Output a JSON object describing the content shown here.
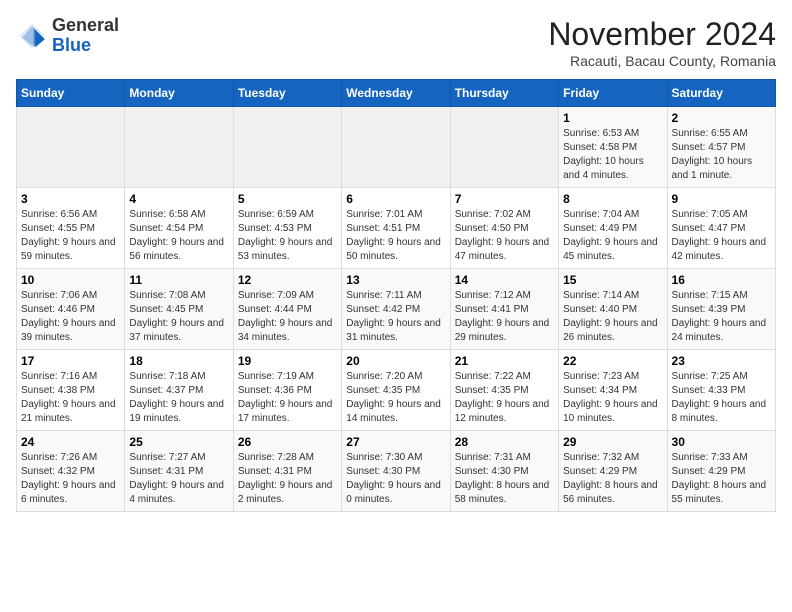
{
  "header": {
    "logo_general": "General",
    "logo_blue": "Blue",
    "month_title": "November 2024",
    "location": "Racauti, Bacau County, Romania"
  },
  "days_of_week": [
    "Sunday",
    "Monday",
    "Tuesday",
    "Wednesday",
    "Thursday",
    "Friday",
    "Saturday"
  ],
  "weeks": [
    [
      {
        "day": "",
        "info": ""
      },
      {
        "day": "",
        "info": ""
      },
      {
        "day": "",
        "info": ""
      },
      {
        "day": "",
        "info": ""
      },
      {
        "day": "",
        "info": ""
      },
      {
        "day": "1",
        "info": "Sunrise: 6:53 AM\nSunset: 4:58 PM\nDaylight: 10 hours and 4 minutes."
      },
      {
        "day": "2",
        "info": "Sunrise: 6:55 AM\nSunset: 4:57 PM\nDaylight: 10 hours and 1 minute."
      }
    ],
    [
      {
        "day": "3",
        "info": "Sunrise: 6:56 AM\nSunset: 4:55 PM\nDaylight: 9 hours and 59 minutes."
      },
      {
        "day": "4",
        "info": "Sunrise: 6:58 AM\nSunset: 4:54 PM\nDaylight: 9 hours and 56 minutes."
      },
      {
        "day": "5",
        "info": "Sunrise: 6:59 AM\nSunset: 4:53 PM\nDaylight: 9 hours and 53 minutes."
      },
      {
        "day": "6",
        "info": "Sunrise: 7:01 AM\nSunset: 4:51 PM\nDaylight: 9 hours and 50 minutes."
      },
      {
        "day": "7",
        "info": "Sunrise: 7:02 AM\nSunset: 4:50 PM\nDaylight: 9 hours and 47 minutes."
      },
      {
        "day": "8",
        "info": "Sunrise: 7:04 AM\nSunset: 4:49 PM\nDaylight: 9 hours and 45 minutes."
      },
      {
        "day": "9",
        "info": "Sunrise: 7:05 AM\nSunset: 4:47 PM\nDaylight: 9 hours and 42 minutes."
      }
    ],
    [
      {
        "day": "10",
        "info": "Sunrise: 7:06 AM\nSunset: 4:46 PM\nDaylight: 9 hours and 39 minutes."
      },
      {
        "day": "11",
        "info": "Sunrise: 7:08 AM\nSunset: 4:45 PM\nDaylight: 9 hours and 37 minutes."
      },
      {
        "day": "12",
        "info": "Sunrise: 7:09 AM\nSunset: 4:44 PM\nDaylight: 9 hours and 34 minutes."
      },
      {
        "day": "13",
        "info": "Sunrise: 7:11 AM\nSunset: 4:42 PM\nDaylight: 9 hours and 31 minutes."
      },
      {
        "day": "14",
        "info": "Sunrise: 7:12 AM\nSunset: 4:41 PM\nDaylight: 9 hours and 29 minutes."
      },
      {
        "day": "15",
        "info": "Sunrise: 7:14 AM\nSunset: 4:40 PM\nDaylight: 9 hours and 26 minutes."
      },
      {
        "day": "16",
        "info": "Sunrise: 7:15 AM\nSunset: 4:39 PM\nDaylight: 9 hours and 24 minutes."
      }
    ],
    [
      {
        "day": "17",
        "info": "Sunrise: 7:16 AM\nSunset: 4:38 PM\nDaylight: 9 hours and 21 minutes."
      },
      {
        "day": "18",
        "info": "Sunrise: 7:18 AM\nSunset: 4:37 PM\nDaylight: 9 hours and 19 minutes."
      },
      {
        "day": "19",
        "info": "Sunrise: 7:19 AM\nSunset: 4:36 PM\nDaylight: 9 hours and 17 minutes."
      },
      {
        "day": "20",
        "info": "Sunrise: 7:20 AM\nSunset: 4:35 PM\nDaylight: 9 hours and 14 minutes."
      },
      {
        "day": "21",
        "info": "Sunrise: 7:22 AM\nSunset: 4:35 PM\nDaylight: 9 hours and 12 minutes."
      },
      {
        "day": "22",
        "info": "Sunrise: 7:23 AM\nSunset: 4:34 PM\nDaylight: 9 hours and 10 minutes."
      },
      {
        "day": "23",
        "info": "Sunrise: 7:25 AM\nSunset: 4:33 PM\nDaylight: 9 hours and 8 minutes."
      }
    ],
    [
      {
        "day": "24",
        "info": "Sunrise: 7:26 AM\nSunset: 4:32 PM\nDaylight: 9 hours and 6 minutes."
      },
      {
        "day": "25",
        "info": "Sunrise: 7:27 AM\nSunset: 4:31 PM\nDaylight: 9 hours and 4 minutes."
      },
      {
        "day": "26",
        "info": "Sunrise: 7:28 AM\nSunset: 4:31 PM\nDaylight: 9 hours and 2 minutes."
      },
      {
        "day": "27",
        "info": "Sunrise: 7:30 AM\nSunset: 4:30 PM\nDaylight: 9 hours and 0 minutes."
      },
      {
        "day": "28",
        "info": "Sunrise: 7:31 AM\nSunset: 4:30 PM\nDaylight: 8 hours and 58 minutes."
      },
      {
        "day": "29",
        "info": "Sunrise: 7:32 AM\nSunset: 4:29 PM\nDaylight: 8 hours and 56 minutes."
      },
      {
        "day": "30",
        "info": "Sunrise: 7:33 AM\nSunset: 4:29 PM\nDaylight: 8 hours and 55 minutes."
      }
    ]
  ]
}
